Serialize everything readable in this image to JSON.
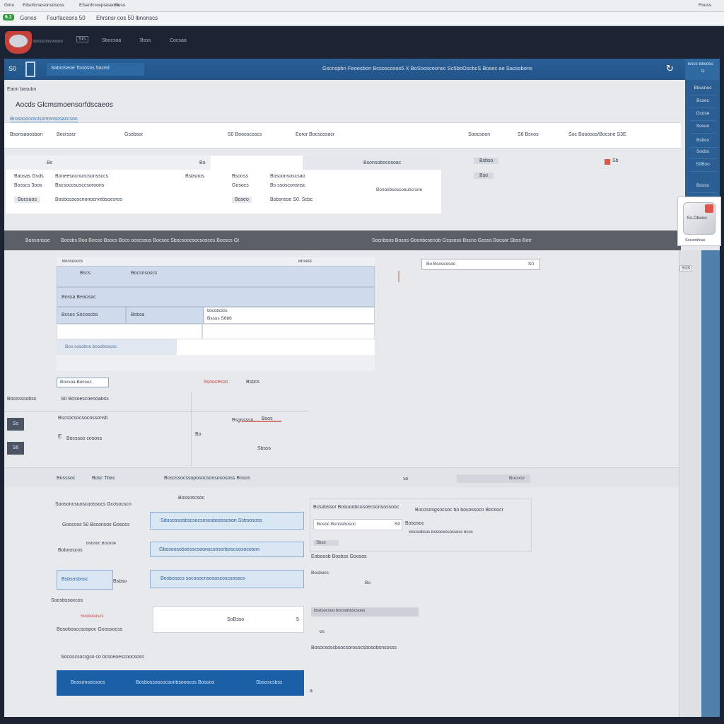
{
  "window": {
    "tabs": [
      "Gmo",
      "Eilsofcrsesonsdsoss",
      "Efsenfcsreprasaoss",
      "Gcso"
    ],
    "right_label": "Rsuss"
  },
  "menubar": {
    "badge": "6.1",
    "items": [
      "Gonos",
      "Fsurfacesns 50",
      "Ehrsnsr cos 50 lbnonscs"
    ]
  },
  "appnav": {
    "logo_alt": "Sbosconsoosod",
    "items": [
      "Srs",
      "Sbocsoa",
      "Bsss",
      "Cocsaa"
    ]
  },
  "bluebar": {
    "left_code": "S0",
    "left_title": "Sabroseoe Tooosos 5aced",
    "center_title": "Gscnspbn Feoesbon Bcsoscosos5 X BoSooscoonsc Sc5boOscbcS Bosec ae Sacsobons",
    "right_top": "Boce Bbodos",
    "right_sub": "G"
  },
  "right_panel": {
    "items": [
      "Bbscnoc",
      "Bcsec",
      "Gcose",
      "Sosoo",
      "Bsbco",
      "Socbs",
      "S0Boo",
      "Bosso"
    ],
    "card_label": "So.Dbeoo",
    "card_caption": "Socsnbfcas"
  },
  "header": {
    "breadcrumb": "Eaon basubn",
    "title": "Aocds Glcmsmoensorfdscaeos",
    "subtitle": "Brosooonosnsoreonsosaccson"
  },
  "summary_row": {
    "cells": [
      "Bsonsaoosbon",
      "Bocrsscr",
      "Gsobsor",
      "S0 Boooscoscs",
      "Eoror Bocscosocr",
      "Soocsoon",
      "S6 Bsvos",
      "Soc Booosos/Bocsne S3E"
    ]
  },
  "detail_card": {
    "header_left": "Bs",
    "header_mid": "Bo",
    "header_right": "Bsonsobocosoac",
    "rows": [
      [
        "Baosas Gsds",
        "Boneesocnuncsonssccs",
        "Bsbsoos",
        "Bsooss",
        "Bosoonsoscsao"
      ],
      [
        "Bosscs 3oos",
        "Bscsocosusccsoroons",
        "",
        "Gosocs",
        "Bs ssosconsnsc"
      ],
      [
        "Bocsuos",
        "Bosbossoscnonocrvebsoesros",
        "",
        "Boseo",
        "Bsbsnsse S0. Scbc"
      ]
    ],
    "side_note": "Bonosbsoscoeuscrsne",
    "badge_a": "Bsbso",
    "badge_b": "Bso"
  },
  "alert_flag": "Sb",
  "dark_strip": {
    "left": "Bossonsoe",
    "mid": "Bocsbs Boo Bocso Bsocs Bocs ooscssus Bocsoc Sbscsoocsocsosces Bocscs Gt",
    "right": "Socnbsos Bosos Goonbcsenob Gsssoss Bscno Gosss Bocsor Sbss Botr"
  },
  "form_panel": {
    "top_left": "Bonsosocs",
    "top_right": "Bnsesc",
    "row1_a": "Bscs",
    "row1_b": "Bocsnsoscs",
    "row2": "Bossa Beaosac",
    "row3_a": "Bcsos Socoscbs",
    "row3_b": "Bsbsa",
    "row3_c": "Bscobcsss",
    "row3_d": "Bssus S6b6",
    "row4": "Bos coscbos bosoboscsc"
  },
  "search": {
    "placeholder": "Bo Bsoscosoc",
    "button": "S0"
  },
  "page_counter": "S0S",
  "toolbar2": {
    "dropdown": "Bocsoa Bocsoc",
    "tag_red": "Ssnocesos",
    "tag_blue": "Bsbcs"
  },
  "list_block": {
    "label": "Bbossssobss",
    "title": "S0 Bosoescoeooabss",
    "btn1": "Ss",
    "btn2": "S6",
    "line1": "Bscsocsocsocossonsb",
    "line2": "Bocssos cososs",
    "line2_prefix": "E",
    "right_label": "Bsgosssn",
    "right_value": "Bsos",
    "right_marker": "Bo",
    "right_bottom": "Sbsss"
  },
  "strip2": {
    "a": "Bosssoc",
    "b": "Bosc Tbac",
    "c": "Bosossocssoposocsonsosososs Bosos",
    "d": "Sb",
    "e": "Bococo"
  },
  "lower_form": {
    "caption": "Bossoscsoc",
    "labels": [
      "Soosoncsuoscoossocs Gcosocscn",
      "Gooccos 50 Bsconsos Gosocs",
      "Bobooscos",
      "Bsbooc Bocnoe",
      "Soosbssoccos",
      "Bosobosccsospoc Goossocss",
      "Socoscsocrgso co bcsoeoescoocsoss"
    ],
    "field1": "Sdosossosbscsocsnsosbosssoson Ssbsososs",
    "field2": "Gbosoosobsesscsoonscsossnbsscsosocoson",
    "field3": "Bosbosscs socosocnsososcoscsossco",
    "small_btn": "Bsbsosbosc",
    "small_btn_suffix": "Bsbso",
    "sub_under": "Soosososcs",
    "white_field": "SoBsso",
    "white_field_suffix": "5"
  },
  "lower_right": {
    "label1": "Bcsobssor Bosooobcosoecsonsossooc",
    "label2": "Bocososgsocsoc bo bosossoco Bocsocr",
    "input": "Bosoc Bsnosbosoc",
    "input_btn": "S0",
    "input_suffix": "Bososoc",
    "subtext": "Bsosobsos bosoceosocsosc bcos",
    "chip": "Sbso",
    "text2": "Eoboosb Bosbss Goosos",
    "text3": "Bosbocs",
    "text3b": "Bo",
    "grey_label": "Bsosocsoo bocsonbscsoos",
    "text4": "Bs",
    "text5": "Bosocsoscbsocsorosocsbosobsnsosss"
  },
  "footer_bar": {
    "left": "Bossonsocsocs",
    "mid": "Bosbossoscocsonbsooscos Bosoos",
    "right": "Sbsoscsbss",
    "marker": "a"
  },
  "colors": {
    "nav_dark": "#1c2433",
    "blue_bar": "#2a5f94",
    "accent_blue": "#1b5fa6",
    "alert_red": "#e0554a",
    "badge_green": "#2e9b3c"
  }
}
